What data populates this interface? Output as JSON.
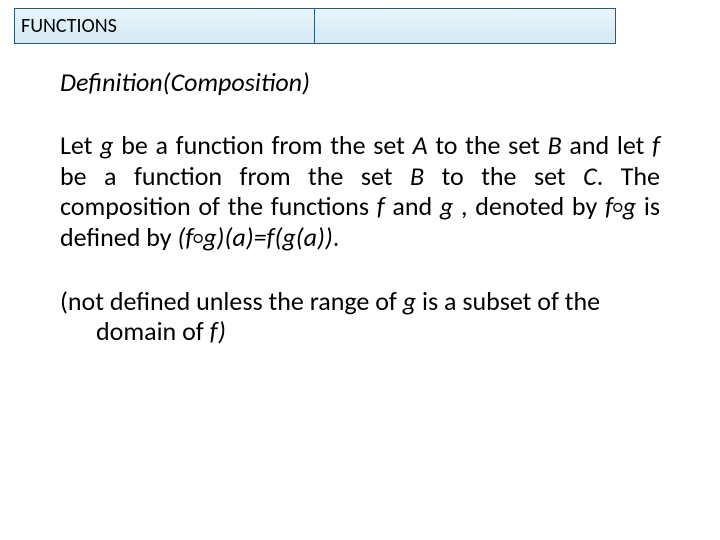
{
  "header": {
    "title": "FUNCTIONS"
  },
  "content": {
    "heading": "Definition(Composition)",
    "def": {
      "p1a": "Let ",
      "g1": "g",
      "p1b": " be a function from the set ",
      "A": "A",
      "p1c": " to the set ",
      "B1": "B",
      "p1d": " and let ",
      "f1": "f",
      "p1e": " be a function from the set ",
      "B2": "B",
      "p1f": " to the set ",
      "C": "C",
      "p1g": ". The composition of the functions ",
      "f2": "f",
      "p1h": " and ",
      "g2": "g",
      "p1i": " , denoted by ",
      "f3": "f",
      "op1": "○",
      "g3": "g",
      "p1j": " is defined by ",
      "lp": "(f",
      "op2": "○",
      "rp": "g)(a)=f(g(a))",
      "dot": "."
    },
    "note": {
      "n1": "(not defined unless the range of ",
      "g": "g",
      "n2": " is a subset of the domain of ",
      "f": "f)"
    }
  }
}
